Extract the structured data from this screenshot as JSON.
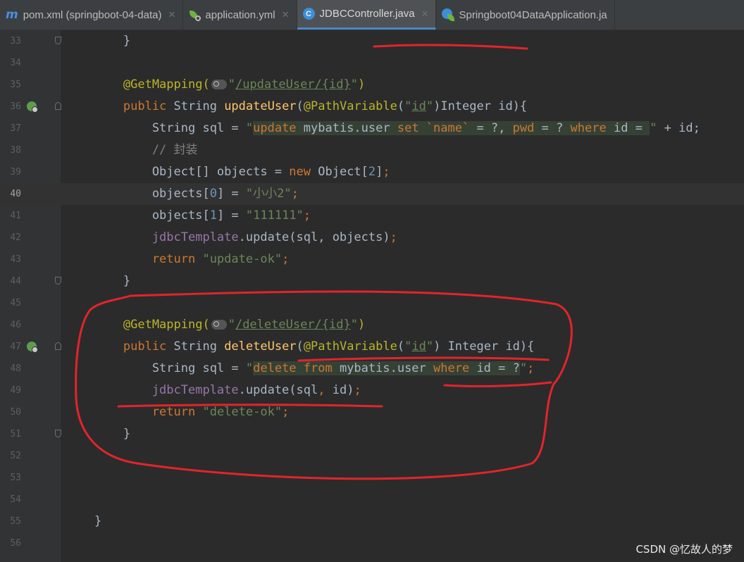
{
  "tabs": [
    {
      "label": "pom.xml (springboot-04-data)",
      "icon": "maven-icon",
      "active": false
    },
    {
      "label": "application.yml",
      "icon": "spring-yml-icon",
      "active": false
    },
    {
      "label": "JDBCController.java",
      "icon": "java-class-icon",
      "active": true
    },
    {
      "label": "Springboot04DataApplication.ja",
      "icon": "spring-boot-app-icon",
      "active": false
    }
  ],
  "editor": {
    "current_line": 40,
    "lines": [
      {
        "n": 33,
        "tokens": [
          [
            "",
            "        }"
          ]
        ]
      },
      {
        "n": 34,
        "tokens": []
      },
      {
        "n": 35,
        "tokens": [
          [
            "an",
            "        @GetMapping("
          ],
          [
            "chip",
            ""
          ],
          [
            "st",
            "\""
          ],
          [
            "st u",
            "/updateUser/{id}"
          ],
          [
            "st",
            "\""
          ],
          [
            "an",
            ")"
          ]
        ]
      },
      {
        "n": 36,
        "tokens": [
          [
            "kw",
            "        public "
          ],
          [
            "",
            "String "
          ],
          [
            "fn",
            "updateUser"
          ],
          [
            "",
            "("
          ],
          [
            "an",
            "@PathVariable"
          ],
          [
            "",
            "("
          ],
          [
            "st",
            "\""
          ],
          [
            "st u",
            "id"
          ],
          [
            "st",
            "\""
          ],
          [
            "",
            ")Integer id){"
          ]
        ]
      },
      {
        "n": 37,
        "tokens": [
          [
            "",
            "            String sql = "
          ],
          [
            "st",
            "\""
          ],
          [
            "sql",
            "update"
          ],
          [
            "sql-t",
            " mybatis.user "
          ],
          [
            "sql",
            "set "
          ],
          [
            "sql",
            "`name`"
          ],
          [
            "sql-t",
            " = ?, "
          ],
          [
            "sql",
            "pwd"
          ],
          [
            "sql-t",
            " = ? "
          ],
          [
            "sql",
            "where"
          ],
          [
            "sql-t",
            " id = "
          ],
          [
            "st",
            "\""
          ],
          [
            "",
            " + id;"
          ]
        ]
      },
      {
        "n": 38,
        "tokens": [
          [
            "cm",
            "            // 封装"
          ]
        ]
      },
      {
        "n": 39,
        "tokens": [
          [
            "",
            "            Object[] objects = "
          ],
          [
            "kw",
            "new "
          ],
          [
            "",
            "Object["
          ],
          [
            "num",
            "2"
          ],
          [
            "",
            "]"
          ],
          [
            "kw",
            ";"
          ]
        ]
      },
      {
        "n": 40,
        "tokens": [
          [
            "",
            "            objects["
          ],
          [
            "num",
            "0"
          ],
          [
            "",
            "] = "
          ],
          [
            "st",
            "\"小小2\""
          ],
          [
            "kw",
            ";"
          ]
        ]
      },
      {
        "n": 41,
        "tokens": [
          [
            "",
            "            objects["
          ],
          [
            "num",
            "1"
          ],
          [
            "",
            "] = "
          ],
          [
            "st",
            "\"111111\""
          ],
          [
            "kw",
            ";"
          ]
        ]
      },
      {
        "n": 42,
        "tokens": [
          [
            "fld",
            "            jdbcTemplate"
          ],
          [
            "",
            ".update(sql, objects)"
          ],
          [
            "kw",
            ";"
          ]
        ]
      },
      {
        "n": 43,
        "tokens": [
          [
            "kw",
            "            return "
          ],
          [
            "st",
            "\"update-ok\""
          ],
          [
            "kw",
            ";"
          ]
        ]
      },
      {
        "n": 44,
        "tokens": [
          [
            "",
            "        }"
          ]
        ]
      },
      {
        "n": 45,
        "tokens": []
      },
      {
        "n": 46,
        "tokens": [
          [
            "an",
            "        @GetMapping("
          ],
          [
            "chip",
            ""
          ],
          [
            "st",
            "\""
          ],
          [
            "st u",
            "/deleteUser/{id}"
          ],
          [
            "st",
            "\""
          ],
          [
            "an",
            ")"
          ]
        ]
      },
      {
        "n": 47,
        "tokens": [
          [
            "kw",
            "        public "
          ],
          [
            "",
            "String "
          ],
          [
            "fn",
            "deleteUser"
          ],
          [
            "",
            "("
          ],
          [
            "an",
            "@PathVariable"
          ],
          [
            "",
            "("
          ],
          [
            "st",
            "\""
          ],
          [
            "st u",
            "id"
          ],
          [
            "st",
            "\""
          ],
          [
            "",
            ") Integer id){"
          ]
        ]
      },
      {
        "n": 48,
        "tokens": [
          [
            "",
            "            String sql = "
          ],
          [
            "st",
            "\""
          ],
          [
            "sql",
            "delete from"
          ],
          [
            "sql-t",
            " mybatis.user "
          ],
          [
            "sql",
            "where"
          ],
          [
            "sql-t",
            " id = ?"
          ],
          [
            "st",
            "\""
          ],
          [
            "kw",
            ";"
          ]
        ]
      },
      {
        "n": 49,
        "tokens": [
          [
            "fld",
            "            jdbcTemplate"
          ],
          [
            "",
            ".update(sql"
          ],
          [
            "kw",
            ", "
          ],
          [
            "",
            "id)"
          ],
          [
            "kw",
            ";"
          ]
        ]
      },
      {
        "n": 50,
        "tokens": [
          [
            "kw",
            "            return "
          ],
          [
            "st",
            "\"delete-ok\""
          ],
          [
            "kw",
            ";"
          ]
        ]
      },
      {
        "n": 51,
        "tokens": [
          [
            "",
            "        }"
          ]
        ]
      },
      {
        "n": 52,
        "tokens": []
      },
      {
        "n": 53,
        "tokens": []
      },
      {
        "n": 54,
        "tokens": []
      },
      {
        "n": 55,
        "tokens": [
          [
            "",
            "    }"
          ]
        ]
      },
      {
        "n": 56,
        "tokens": []
      }
    ],
    "gutter_icons": {
      "36": "spring-web-endpoint-icon",
      "47": "spring-web-endpoint-icon"
    },
    "fold_markers": {
      "33": "end",
      "36": "start",
      "44": "end",
      "47": "start",
      "51": "end"
    }
  },
  "watermark": "CSDN @忆故人的梦",
  "colors": {
    "annotation_ink": "#e3242b",
    "editor_bg": "#2b2b2b",
    "gutter_bg": "#313335"
  }
}
